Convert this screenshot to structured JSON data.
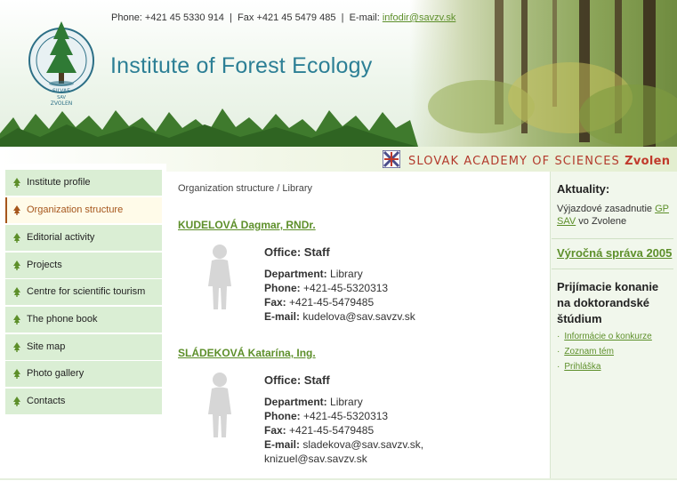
{
  "header": {
    "phone_label": "Phone: +421 45 5330 914",
    "fax_label": "Fax +421 45 5479 485",
    "email_prefix": "E-mail:",
    "email": "infodir@savzv.sk",
    "title": "Institute of Forest Ecology",
    "logo_text": "INSTITUTUM ECOLOGIAE SILVAE SAV ZVOLEN"
  },
  "academy": {
    "name": "SLOVAK ACADEMY OF SCIENCES",
    "city": "Zvolen"
  },
  "nav": {
    "items": [
      {
        "label": "Institute profile"
      },
      {
        "label": "Organization structure"
      },
      {
        "label": "Editorial activity"
      },
      {
        "label": "Projects"
      },
      {
        "label": "Centre for scientific tourism"
      },
      {
        "label": "The phone book"
      },
      {
        "label": "Site map"
      },
      {
        "label": "Photo gallery"
      },
      {
        "label": "Contacts"
      }
    ]
  },
  "main": {
    "breadcrumb": "Organization structure / Library",
    "people": [
      {
        "name": "KUDELOVÁ Dagmar, RNDr.",
        "office": "Office: Staff",
        "department_label": "Department:",
        "department": "Library",
        "phone_label": "Phone:",
        "phone": "+421-45-5320313",
        "fax_label": "Fax:",
        "fax": "+421-45-5479485",
        "email_label": "E-mail:",
        "email": "kudelova@sav.savzv.sk"
      },
      {
        "name": "SLÁDEKOVÁ Katarína, Ing.",
        "office": "Office: Staff",
        "department_label": "Department:",
        "department": "Library",
        "phone_label": "Phone:",
        "phone": "+421-45-5320313",
        "fax_label": "Fax:",
        "fax": "+421-45-5479485",
        "email_label": "E-mail:",
        "email": "sladekova@sav.savzv.sk,",
        "email2": "knizuel@sav.savzv.sk"
      }
    ]
  },
  "sidebar": {
    "news_title": "Aktuality:",
    "news_text": "Výjazdové zasadnutie",
    "news_link": "GP SAV",
    "news_suffix": "vo Zvolene",
    "report_link": "Výročná správa 2005",
    "admission_title": "Prijímacie konanie na doktorandské štúdium",
    "links": [
      {
        "label": "Informácie o konkurze"
      },
      {
        "label": "Zoznam tém"
      },
      {
        "label": "Prihláška"
      }
    ]
  },
  "colors": {
    "accent_green": "#5d8f2a",
    "title_blue": "#2c7f95",
    "academy_red": "#b33a2c",
    "nav_bg": "#daeed4",
    "nav_active_text": "#a6561c"
  }
}
